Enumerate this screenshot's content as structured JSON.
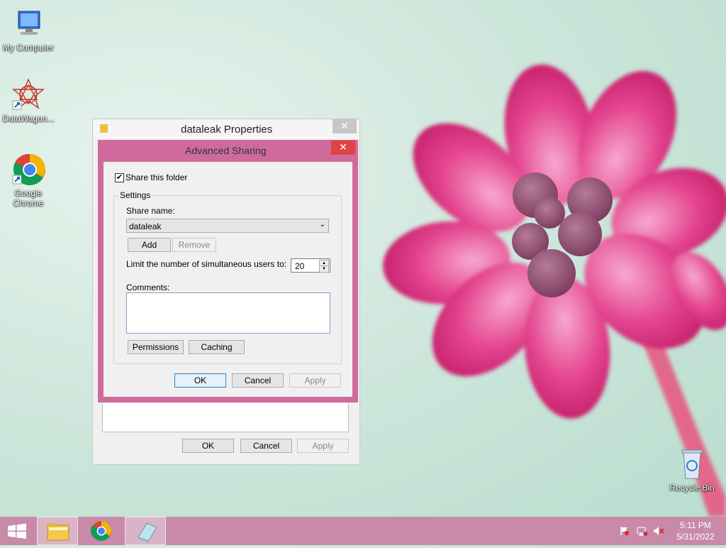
{
  "desktop": {
    "icons": [
      {
        "label": "My Computer"
      },
      {
        "label": "DataWagon..."
      },
      {
        "label": "Google Chrome"
      },
      {
        "label": "Recycle Bin"
      }
    ]
  },
  "properties_window": {
    "title": "dataleak Properties",
    "close_label": "✕",
    "ok_label": "OK",
    "cancel_label": "Cancel",
    "apply_label": "Apply"
  },
  "advanced_sharing": {
    "title": "Advanced Sharing",
    "close_label": "✕",
    "share_checkbox_label": "Share this folder",
    "share_checked": true,
    "settings_group_label": "Settings",
    "share_name_label": "Share name:",
    "share_name_value": "dataleak",
    "add_label": "Add",
    "remove_label": "Remove",
    "limit_label": "Limit the number of simultaneous users to:",
    "limit_value": "20",
    "comments_label": "Comments:",
    "comments_value": "",
    "permissions_label": "Permissions",
    "caching_label": "Caching",
    "ok_label": "OK",
    "cancel_label": "Cancel",
    "apply_label": "Apply"
  },
  "taskbar": {
    "time": "5:11 PM",
    "date": "5/31/2022",
    "items": [
      "start",
      "file-explorer",
      "chrome",
      "notepad"
    ]
  },
  "colors": {
    "accent_pink": "#cf6b9c",
    "taskbar": "#c88aa8",
    "close_red": "#e04343"
  }
}
